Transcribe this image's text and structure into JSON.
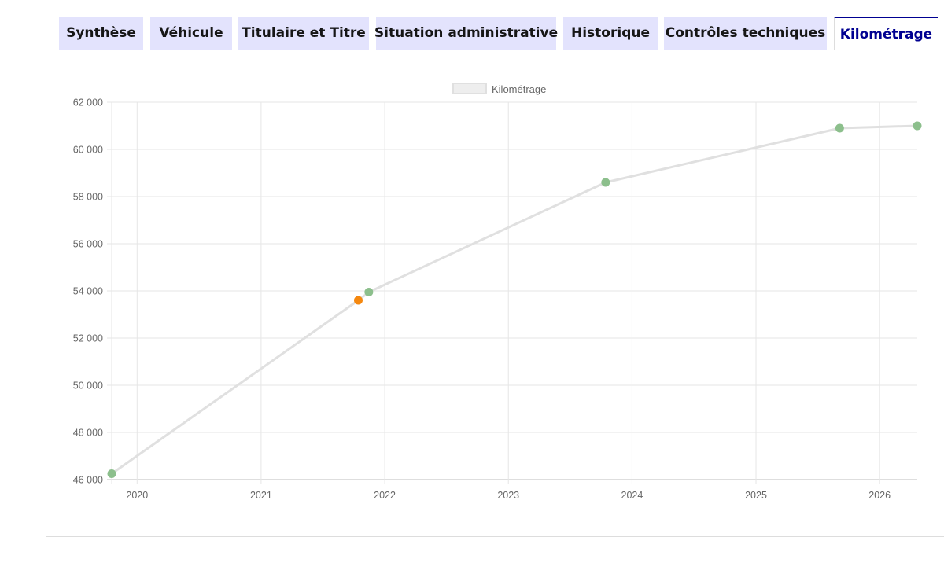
{
  "tabs": [
    {
      "label": "Synthèse",
      "active": false
    },
    {
      "label": "Véhicule",
      "active": false
    },
    {
      "label": "Titulaire et Titre",
      "active": false
    },
    {
      "label": "Situation administrative",
      "active": false
    },
    {
      "label": "Historique",
      "active": false
    },
    {
      "label": "Contrôles techniques",
      "active": false
    },
    {
      "label": "Kilométrage",
      "active": true
    }
  ],
  "colors": {
    "tab_bg": "#e3e3fd",
    "tab_active_text": "#000091",
    "line": "#e0e0e0",
    "point_green": "#8cbf8c",
    "point_orange": "#f5880f"
  },
  "chart_data": {
    "type": "line",
    "title": "",
    "xlabel": "",
    "ylabel": "",
    "legend": {
      "label": "Kilométrage",
      "position": "top"
    },
    "grid": true,
    "x_ticks": [
      "2020",
      "2021",
      "2022",
      "2023",
      "2024",
      "2025",
      "2026"
    ],
    "y_ticks": [
      "46 000",
      "48 000",
      "50 000",
      "52 000",
      "54 000",
      "56 000",
      "58 000",
      "60 000",
      "62 000"
    ],
    "xlim": [
      "2019-10-18",
      "2026-04-22"
    ],
    "ylim": [
      46000,
      62000
    ],
    "series": [
      {
        "name": "Kilométrage",
        "points": [
          {
            "date": "2019-10-18",
            "value": 46250,
            "status": "ok"
          },
          {
            "date": "2021-10-15",
            "value": 53600,
            "status": "warning"
          },
          {
            "date": "2021-11-15",
            "value": 53950,
            "status": "ok"
          },
          {
            "date": "2023-10-15",
            "value": 58600,
            "status": "ok"
          },
          {
            "date": "2025-09-05",
            "value": 60900,
            "status": "ok"
          },
          {
            "date": "2026-04-22",
            "value": 61000,
            "status": "ok"
          }
        ]
      }
    ]
  }
}
